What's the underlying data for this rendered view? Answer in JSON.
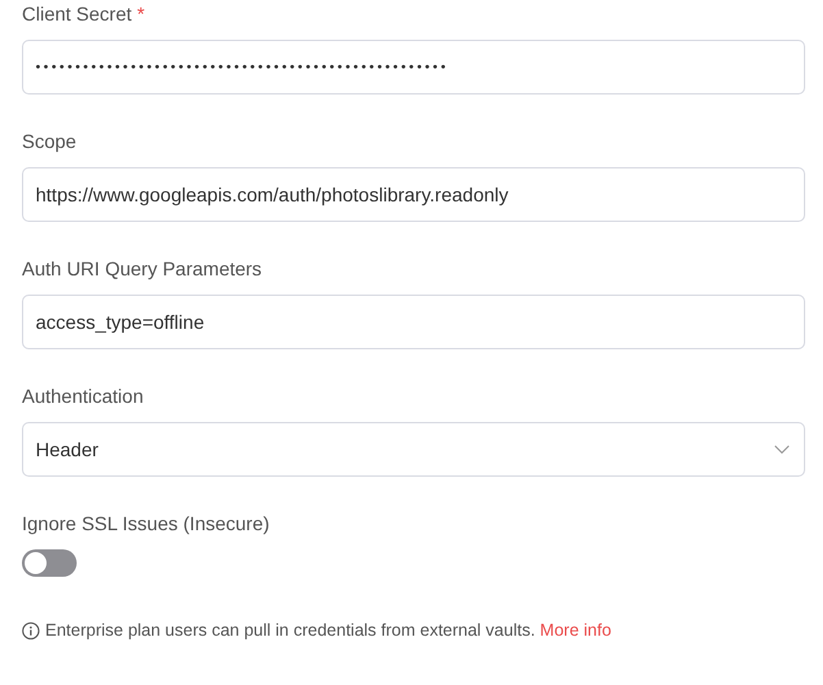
{
  "fields": [
    {
      "kind": "password",
      "label": "Client Secret",
      "required_mark": "*",
      "value": "••••••••••••••••••••••••••••••••••••••••••••••••••••"
    },
    {
      "kind": "text",
      "label": "Scope",
      "value": "https://www.googleapis.com/auth/photoslibrary.readonly"
    },
    {
      "kind": "text",
      "label": "Auth URI Query Parameters",
      "value": "access_type=offline"
    },
    {
      "kind": "select",
      "label": "Authentication",
      "value": "Header"
    },
    {
      "kind": "toggle",
      "label": "Ignore SSL Issues (Insecure)",
      "on": false
    }
  ],
  "note": {
    "text": "Enterprise plan users can pull in credentials from external vaults.",
    "link": "More info"
  }
}
